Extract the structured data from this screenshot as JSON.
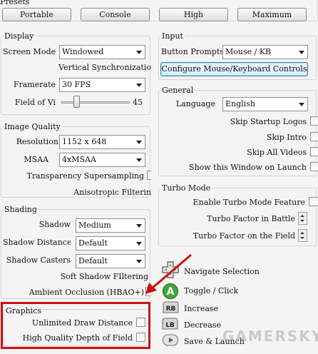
{
  "presets": {
    "title": "Presets",
    "buttons": [
      "Portable",
      "Console",
      "High",
      "Maximum"
    ]
  },
  "display": {
    "title": "Display",
    "screen_mode_label": "Screen Mode",
    "screen_mode_value": "Windowed",
    "vsync_label": "Vertical Synchronizatio",
    "framerate_label": "Framerate",
    "framerate_value": "30 FPS",
    "fov_label": "Field of Vi",
    "fov_value": "45",
    "fov_level": 0.2
  },
  "image_quality": {
    "title": "Image Quality",
    "resolution_label": "Resolution",
    "resolution_value": "1152 x 648",
    "msaa_label": "MSAA",
    "msaa_value": "4xMSAA",
    "transparency_label": "Transparency Supersampling",
    "aniso_label": "Anisotropic Filterin"
  },
  "shading": {
    "title": "Shading",
    "shadow_label": "Shadow",
    "shadow_value": "Medium",
    "shadow_distance_label": "Shadow Distance",
    "shadow_distance_value": "Default",
    "shadow_casters_label": "Shadow Casters",
    "shadow_casters_value": "Default",
    "soft_shadow_label": "Soft Shadow FIltering",
    "ao_label": "Ambient Occlusion (HBAO+)"
  },
  "graphics": {
    "title": "Graphics",
    "unlimited_draw_label": "Unlimited Draw Distance",
    "hq_dof_label": "High Quality Depth of Field"
  },
  "input": {
    "title": "Input",
    "button_prompts_label": "Button Prompts",
    "button_prompts_value": "Mouse / KB",
    "configure_button": "Configure Mouse/Keyboard Controls"
  },
  "general": {
    "title": "General",
    "language_label": "Language",
    "language_value": "English",
    "skip_startup_label": "Skip Startup Logos",
    "skip_intro_label": "Skip Intro",
    "skip_videos_label": "Skip All Videos",
    "show_window_label": "Show this Window on Launch"
  },
  "turbo": {
    "title": "Turbo Mode",
    "enable_label": "Enable Turbo Mode Feature",
    "battle_label": "Turbo Factor in Battle",
    "field_label": "Turbo Factor on the Field"
  },
  "controls": [
    {
      "icon": "dpad-icon",
      "glyph": "✚",
      "label": "Navigate Selection"
    },
    {
      "icon": "a-button-icon",
      "glyph": "A",
      "label": "Toggle / Click"
    },
    {
      "icon": "rb-button-icon",
      "glyph": "RB",
      "label": "Increase"
    },
    {
      "icon": "lb-button-icon",
      "glyph": "LB",
      "label": "Decrease"
    },
    {
      "icon": "start-button-icon",
      "glyph": "▶",
      "label": "Save & Launch"
    }
  ],
  "watermark": "GAMERSKY",
  "colors": {
    "highlight_box": "#cc1111",
    "arrow": "#cc1111",
    "a_button": "#3fa83a"
  }
}
